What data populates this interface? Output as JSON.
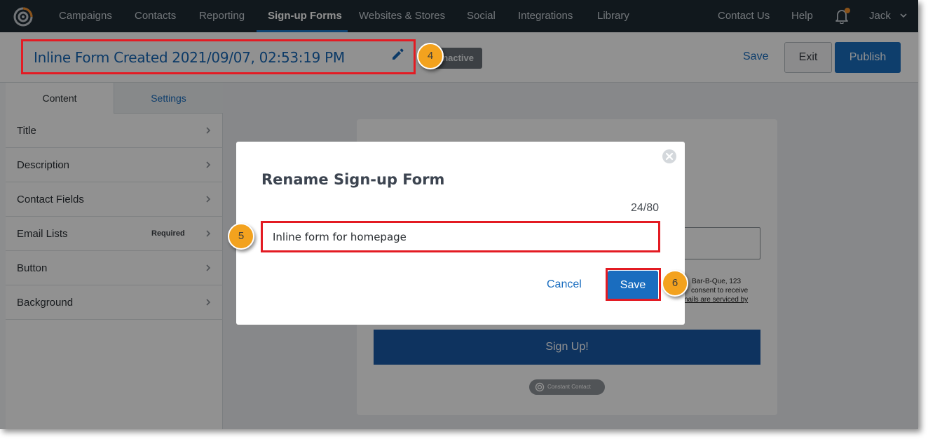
{
  "nav": {
    "items": [
      "Campaigns",
      "Contacts",
      "Reporting",
      "Sign-up Forms",
      "Websites & Stores",
      "Social",
      "Integrations",
      "Library"
    ],
    "right": [
      "Contact Us",
      "Help"
    ],
    "user": "Jack",
    "accent": "#1a77c9"
  },
  "header": {
    "form_title": "Inline Form Created 2021/09/07, 02:53:19 PM",
    "status_badge": "Inactive",
    "save": "Save",
    "exit": "Exit",
    "publish": "Publish"
  },
  "sidebar": {
    "tabs": [
      "Content",
      "Settings"
    ],
    "rows": [
      {
        "label": "Title",
        "tag": ""
      },
      {
        "label": "Description",
        "tag": ""
      },
      {
        "label": "Contact Fields",
        "tag": ""
      },
      {
        "label": "Email Lists",
        "tag": "Required"
      },
      {
        "label": "Button",
        "tag": ""
      },
      {
        "label": "Background",
        "tag": ""
      }
    ]
  },
  "preview": {
    "consent_lines": [
      "Bar-B-Que, 123",
      "consent to receive",
      "nails are serviced by"
    ],
    "signup_button": "Sign Up!",
    "brand": "Constant Contact"
  },
  "modal": {
    "title": "Rename Sign-up Form",
    "counter": "24/80",
    "input_value": "Inline form for homepage",
    "cancel": "Cancel",
    "save": "Save"
  },
  "annotations": {
    "step_4": "4",
    "step_5": "5",
    "step_6": "6",
    "highlight_color": "#e31b23",
    "marker_color": "#f3a21e"
  }
}
